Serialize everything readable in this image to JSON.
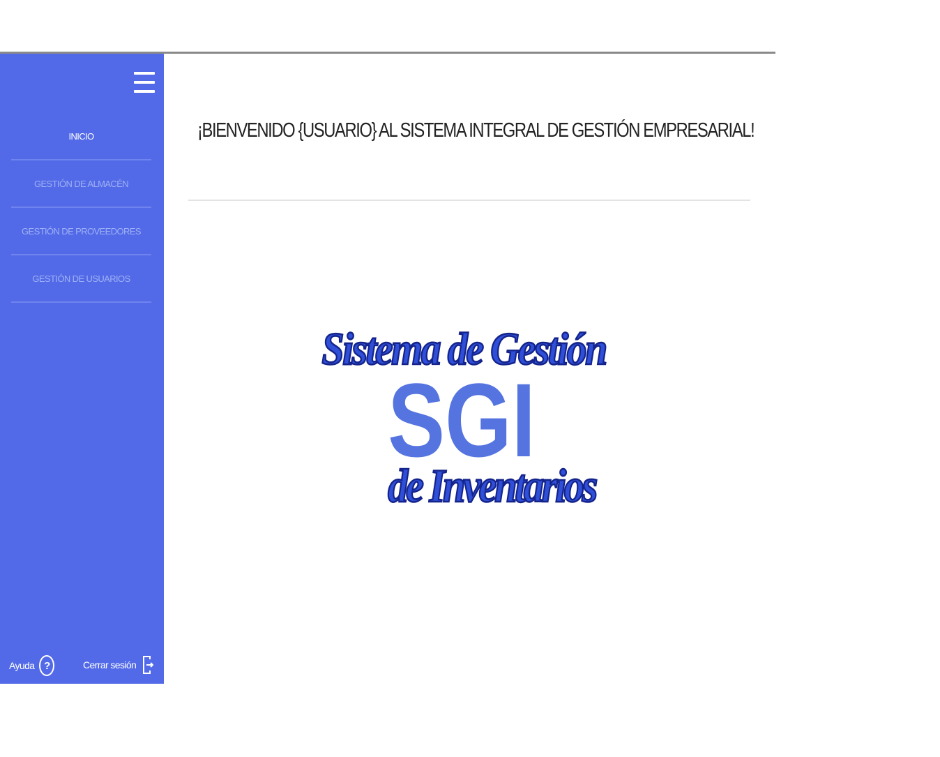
{
  "welcome": {
    "title": "¡BIENVENIDO {USUARIO} AL SISTEMA INTEGRAL DE GESTIÓN EMPRESARIAL!"
  },
  "sidebar": {
    "menu_icon": "hamburger-menu-icon",
    "items": [
      {
        "label": "INICIO",
        "active": true
      },
      {
        "label": "GESTIÓN DE ALMACÉN",
        "active": false
      },
      {
        "label": "GESTIÓN DE PROVEEDORES",
        "active": false
      },
      {
        "label": "GESTIÓN DE USUARIOS",
        "active": false
      }
    ],
    "footer": {
      "help_label": "Ayuda",
      "help_icon": "question-circle-icon",
      "logout_label": "Cerrar sesión",
      "logout_icon": "logout-door-icon"
    }
  },
  "logo": {
    "line1": "Sistema de Gestión",
    "line2": "SGI",
    "line3": "de Inventarios"
  },
  "colors": {
    "sidebar_bg": "#526ae7",
    "logo_script": "#2f4fd8",
    "logo_block": "#5574e0"
  }
}
